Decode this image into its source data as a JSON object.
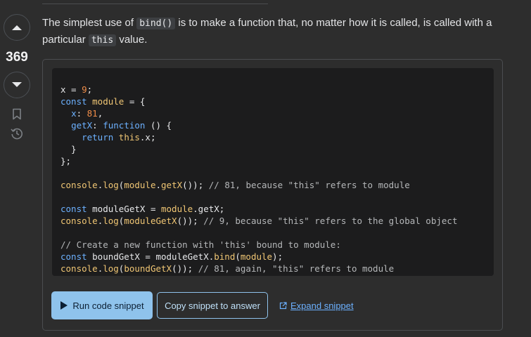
{
  "vote": {
    "score": "369"
  },
  "intro": {
    "text_before": "The simplest use of ",
    "code1": "bind()",
    "text_middle": " is to make a function that, no matter how it is called, is called with a particular ",
    "code2": "this",
    "text_after": " value."
  },
  "code_lines": [
    [
      [
        "pl",
        "x = "
      ],
      [
        "num",
        "9"
      ],
      [
        "pl",
        ";"
      ]
    ],
    [
      [
        "kw",
        "const "
      ],
      [
        "fn",
        "module"
      ],
      [
        "pl",
        " = {"
      ]
    ],
    [
      [
        "pl",
        "  "
      ],
      [
        "prop",
        "x"
      ],
      [
        "pl",
        ": "
      ],
      [
        "num",
        "81"
      ],
      [
        "pl",
        ","
      ]
    ],
    [
      [
        "pl",
        "  "
      ],
      [
        "prop",
        "getX"
      ],
      [
        "pl",
        ": "
      ],
      [
        "kw",
        "function"
      ],
      [
        "pl",
        " () {"
      ]
    ],
    [
      [
        "pl",
        "    "
      ],
      [
        "kw",
        "return "
      ],
      [
        "fn",
        "this"
      ],
      [
        "pl",
        ".x;"
      ]
    ],
    [
      [
        "pl",
        "  }"
      ]
    ],
    [
      [
        "pl",
        "};"
      ]
    ],
    [
      [
        "pl",
        ""
      ]
    ],
    [
      [
        "fn",
        "console"
      ],
      [
        "pl",
        "."
      ],
      [
        "fn",
        "log"
      ],
      [
        "pl",
        "("
      ],
      [
        "fn",
        "module"
      ],
      [
        "pl",
        "."
      ],
      [
        "fn",
        "getX"
      ],
      [
        "pl",
        "()); "
      ],
      [
        "cm",
        "// 81, because \"this\" refers to module"
      ]
    ],
    [
      [
        "pl",
        ""
      ]
    ],
    [
      [
        "kw",
        "const "
      ],
      [
        "pl",
        "moduleGetX = "
      ],
      [
        "fn",
        "module"
      ],
      [
        "pl",
        ".getX;"
      ]
    ],
    [
      [
        "fn",
        "console"
      ],
      [
        "pl",
        "."
      ],
      [
        "fn",
        "log"
      ],
      [
        "pl",
        "("
      ],
      [
        "fn",
        "moduleGetX"
      ],
      [
        "pl",
        "()); "
      ],
      [
        "cm",
        "// 9, because \"this\" refers to the global object"
      ]
    ],
    [
      [
        "pl",
        ""
      ]
    ],
    [
      [
        "cm",
        "// Create a new function with 'this' bound to module:"
      ]
    ],
    [
      [
        "kw",
        "const "
      ],
      [
        "pl",
        "boundGetX = moduleGetX."
      ],
      [
        "fn",
        "bind"
      ],
      [
        "pl",
        "("
      ],
      [
        "fn",
        "module"
      ],
      [
        "pl",
        ");"
      ]
    ],
    [
      [
        "fn",
        "console"
      ],
      [
        "pl",
        "."
      ],
      [
        "fn",
        "log"
      ],
      [
        "pl",
        "("
      ],
      [
        "fn",
        "boundGetX"
      ],
      [
        "pl",
        "()); "
      ],
      [
        "cm",
        "// 81, again, \"this\" refers to module"
      ]
    ]
  ],
  "actions": {
    "run_label": "Run code snippet",
    "copy_label": "Copy snippet to answer",
    "expand_label": "Expand snippet"
  },
  "icons": {
    "vote_up": "arrow-up-icon",
    "vote_down": "arrow-down-icon",
    "bookmark": "bookmark-icon",
    "history": "history-icon",
    "run": "play-icon",
    "expand": "external-link-icon"
  }
}
